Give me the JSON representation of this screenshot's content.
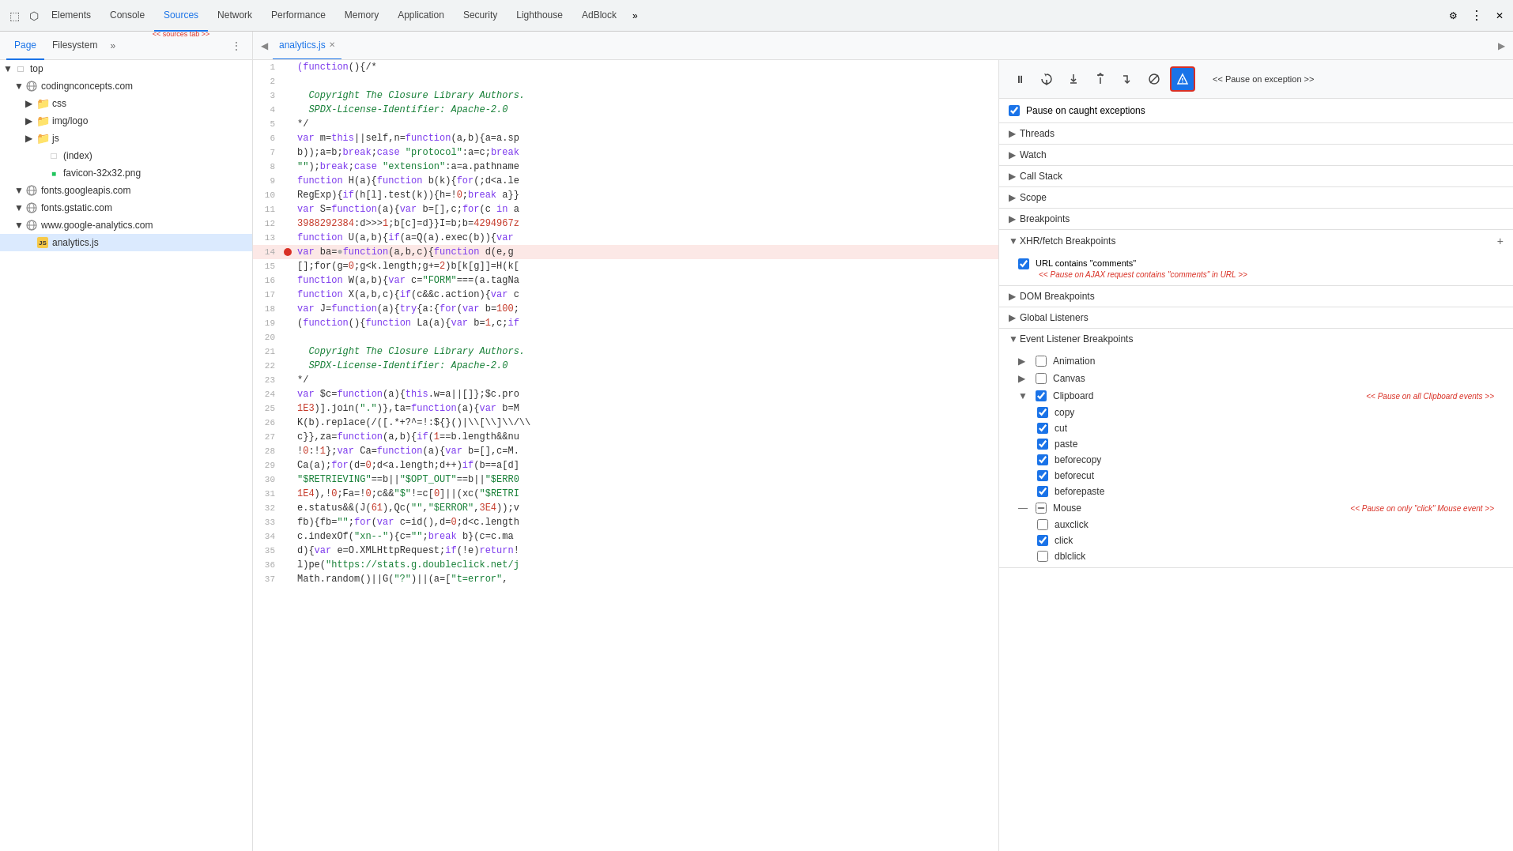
{
  "tabs": {
    "items": [
      {
        "label": "Elements",
        "active": false
      },
      {
        "label": "Console",
        "active": false
      },
      {
        "label": "Sources",
        "active": true
      },
      {
        "label": "Network",
        "active": false
      },
      {
        "label": "Performance",
        "active": false
      },
      {
        "label": "Memory",
        "active": false
      },
      {
        "label": "Application",
        "active": false
      },
      {
        "label": "Security",
        "active": false
      },
      {
        "label": "Lighthouse",
        "active": false
      },
      {
        "label": "AdBlock",
        "active": false
      }
    ],
    "sources_arrow": "<< sources tab >>",
    "more_label": "»",
    "settings_label": "⚙",
    "close_label": "✕"
  },
  "second_row": {
    "page_label": "Page",
    "filesystem_label": "Filesystem",
    "more_label": "»",
    "file_back_label": "◀",
    "file_tab_label": "analytics.js",
    "file_tab_close": "✕",
    "file_play_label": "▶"
  },
  "file_tree": {
    "items": [
      {
        "indent": 0,
        "arrow": "▼",
        "icon": "folder-open",
        "label": "top",
        "type": "folder"
      },
      {
        "indent": 1,
        "arrow": "▼",
        "icon": "domain",
        "label": "codingnconcepts.com",
        "type": "domain"
      },
      {
        "indent": 2,
        "arrow": "▶",
        "icon": "folder",
        "label": "css",
        "type": "folder"
      },
      {
        "indent": 2,
        "arrow": "▶",
        "icon": "folder",
        "label": "img/logo",
        "type": "folder"
      },
      {
        "indent": 2,
        "arrow": "▶",
        "icon": "folder",
        "label": "js",
        "type": "folder"
      },
      {
        "indent": 2,
        "arrow": "",
        "icon": "file",
        "label": "(index)",
        "type": "file"
      },
      {
        "indent": 2,
        "arrow": "",
        "icon": "png",
        "label": "favicon-32x32.png",
        "type": "file"
      },
      {
        "indent": 1,
        "arrow": "▼",
        "icon": "domain",
        "label": "fonts.googleapis.com",
        "type": "domain"
      },
      {
        "indent": 1,
        "arrow": "▼",
        "icon": "domain",
        "label": "fonts.gstatic.com",
        "type": "domain"
      },
      {
        "indent": 1,
        "arrow": "▼",
        "icon": "domain",
        "label": "www.google-analytics.com",
        "type": "domain"
      },
      {
        "indent": 2,
        "arrow": "",
        "icon": "js",
        "label": "analytics.js",
        "type": "js",
        "selected": true
      }
    ]
  },
  "code": {
    "lines": [
      {
        "num": 1,
        "text": "(function(){/*",
        "type": "normal",
        "breakpoint": false
      },
      {
        "num": 2,
        "text": "",
        "type": "normal",
        "breakpoint": false
      },
      {
        "num": 3,
        "text": "  Copyright The Closure Library Authors.",
        "type": "comment",
        "breakpoint": false
      },
      {
        "num": 4,
        "text": "  SPDX-License-Identifier: Apache-2.0",
        "type": "comment",
        "breakpoint": false
      },
      {
        "num": 5,
        "text": "*/",
        "type": "normal",
        "breakpoint": false
      },
      {
        "num": 6,
        "text": "var m=this||self,n=function(a,b){a=a.sp",
        "type": "normal",
        "breakpoint": false
      },
      {
        "num": 7,
        "text": "b));a=b;break;case \"protocol\":a=c;break",
        "type": "normal",
        "breakpoint": false
      },
      {
        "num": 8,
        "text": "\"\");break;case \"extension\":a=a.pathname",
        "type": "normal",
        "breakpoint": false
      },
      {
        "num": 9,
        "text": "function H(a){function b(k){for(;d<a.le",
        "type": "normal",
        "breakpoint": false
      },
      {
        "num": 10,
        "text": "RegExp){if(h[l].test(k)){h=!0;break a}}",
        "type": "normal",
        "breakpoint": false
      },
      {
        "num": 11,
        "text": "var S=function(a){var b=[],c;for(c in a",
        "type": "normal",
        "breakpoint": false
      },
      {
        "num": 12,
        "text": "3988292384:d>>>1;b[c]=d}}I=b;b=4294967z",
        "type": "normal",
        "breakpoint": false
      },
      {
        "num": 13,
        "text": "function U(a,b){if(a=Q(a).exec(b)){var",
        "type": "normal",
        "breakpoint": false
      },
      {
        "num": 14,
        "text": "var ba=●function(a,b,c){function d(e,g",
        "type": "breakpoint",
        "breakpoint": true
      },
      {
        "num": 15,
        "text": "[];for(g=0;g<k.length;g+=2)b[k[g]]=H(k[",
        "type": "normal",
        "breakpoint": false
      },
      {
        "num": 16,
        "text": "function W(a,b){var c=\"FORM\"===(a.tagNa",
        "type": "normal",
        "breakpoint": false
      },
      {
        "num": 17,
        "text": "function X(a,b,c){if(c&&c.action){var c",
        "type": "normal",
        "breakpoint": false
      },
      {
        "num": 18,
        "text": "var J=function(a){try{a:{for(var b=100;",
        "type": "normal",
        "breakpoint": false
      },
      {
        "num": 19,
        "text": "(function(){function La(a){var b=1,c;if",
        "type": "normal",
        "breakpoint": false
      },
      {
        "num": 20,
        "text": "",
        "type": "normal",
        "breakpoint": false
      },
      {
        "num": 21,
        "text": "  Copyright The Closure Library Authors.",
        "type": "comment",
        "breakpoint": false
      },
      {
        "num": 22,
        "text": "  SPDX-License-Identifier: Apache-2.0",
        "type": "comment",
        "breakpoint": false
      },
      {
        "num": 23,
        "text": "*/",
        "type": "normal",
        "breakpoint": false
      },
      {
        "num": 24,
        "text": "var $c=function(a){this.w=a||[]};$c.pro",
        "type": "normal",
        "breakpoint": false
      },
      {
        "num": 25,
        "text": "1E3)].join(\".\")},ta=function(a){var b=M",
        "type": "normal",
        "breakpoint": false
      },
      {
        "num": 26,
        "text": "K(b).replace(/([.*+?^=!:${}()|\\[\\]\\/\\",
        "type": "normal",
        "breakpoint": false
      },
      {
        "num": 27,
        "text": "c}},za=function(a,b){if(1==b.length&&nu",
        "type": "normal",
        "breakpoint": false
      },
      {
        "num": 28,
        "text": "!0:!1};var Ca=function(a){var b=[],c=M.",
        "type": "normal",
        "breakpoint": false
      },
      {
        "num": 29,
        "text": "Ca(a);for(d=0;d<a.length;d++)if(b==a[d]",
        "type": "normal",
        "breakpoint": false
      },
      {
        "num": 30,
        "text": "\"$RETRIEVING\"==b||\"$OPT_OUT\"==b||\"$ERR0",
        "type": "normal",
        "breakpoint": false
      },
      {
        "num": 31,
        "text": "1E4),!0;Fa=!0;c&&\"$\"!=c[0]||(xc(\"$RETRI",
        "type": "normal",
        "breakpoint": false
      },
      {
        "num": 32,
        "text": "e.status&&(J(61),Qc(\"\",\"$ERROR\",3E4));v",
        "type": "normal",
        "breakpoint": false
      },
      {
        "num": 33,
        "text": "fb){fb=\"\";for(var c=id(),d=0;d<c.length",
        "type": "normal",
        "breakpoint": false
      },
      {
        "num": 34,
        "text": "c.indexOf(\"xn--\"){c=\"\";break b}(c=c.ma",
        "type": "normal",
        "breakpoint": false
      },
      {
        "num": 35,
        "text": "d){var e=O.XMLHttpRequest;if(!e)return!",
        "type": "normal",
        "breakpoint": false
      },
      {
        "num": 36,
        "text": "l)pe(\"https://stats.g.doubleclick.net/j",
        "type": "normal",
        "breakpoint": false
      },
      {
        "num": 37,
        "text": "Math.random()||G(\"?\")||(a=[\"t=error\",",
        "type": "normal",
        "breakpoint": false
      }
    ]
  },
  "debugger": {
    "toolbar": {
      "pause_label": "⏸",
      "step_over": "↺",
      "step_into": "↓",
      "step_out": "↑",
      "step_label": "→",
      "deactivate": "⊘",
      "pause_exception_label": "<< Pause on exception >>"
    },
    "pause_caught": {
      "label": "Pause on caught exceptions",
      "checked": true
    },
    "sections": [
      {
        "id": "threads",
        "label": "Threads",
        "collapsed": true,
        "has_add": false
      },
      {
        "id": "watch",
        "label": "Watch",
        "collapsed": true,
        "has_add": false
      },
      {
        "id": "call_stack",
        "label": "Call Stack",
        "collapsed": true,
        "has_add": false
      },
      {
        "id": "scope",
        "label": "Scope",
        "collapsed": true,
        "has_add": false
      },
      {
        "id": "breakpoints",
        "label": "Breakpoints",
        "collapsed": true,
        "has_add": false
      },
      {
        "id": "xhr_breakpoints",
        "label": "XHR/fetch Breakpoints",
        "collapsed": false,
        "has_add": true
      },
      {
        "id": "dom_breakpoints",
        "label": "DOM Breakpoints",
        "collapsed": true,
        "has_add": false
      },
      {
        "id": "global_listeners",
        "label": "Global Listeners",
        "collapsed": true,
        "has_add": false
      },
      {
        "id": "event_listener_breakpoints",
        "label": "Event Listener Breakpoints",
        "collapsed": false,
        "has_add": false
      }
    ],
    "xhr_items": [
      {
        "label": "URL contains \"comments\"",
        "checked": true,
        "note": "<< Pause on AJAX request contains \"comments\" in URL >>"
      }
    ],
    "event_groups": [
      {
        "id": "animation",
        "label": "Animation",
        "expanded": false,
        "checked": false,
        "indeterminate": false,
        "note": "",
        "items": []
      },
      {
        "id": "canvas",
        "label": "Canvas",
        "expanded": false,
        "checked": false,
        "indeterminate": false,
        "note": "",
        "items": []
      },
      {
        "id": "clipboard",
        "label": "Clipboard",
        "expanded": true,
        "checked": true,
        "indeterminate": false,
        "note": "<< Pause on all Clipboard events >>",
        "items": [
          {
            "label": "copy",
            "checked": true
          },
          {
            "label": "cut",
            "checked": true
          },
          {
            "label": "paste",
            "checked": true
          },
          {
            "label": "beforecopy",
            "checked": true
          },
          {
            "label": "beforecut",
            "checked": true
          },
          {
            "label": "beforepaste",
            "checked": true
          }
        ]
      },
      {
        "id": "mouse",
        "label": "Mouse",
        "expanded": true,
        "checked": false,
        "indeterminate": true,
        "note": "<< Pause on only \"click\" Mouse event >>",
        "items": [
          {
            "label": "auxclick",
            "checked": false
          },
          {
            "label": "click",
            "checked": true
          },
          {
            "label": "dblclick",
            "checked": false
          }
        ]
      }
    ]
  }
}
